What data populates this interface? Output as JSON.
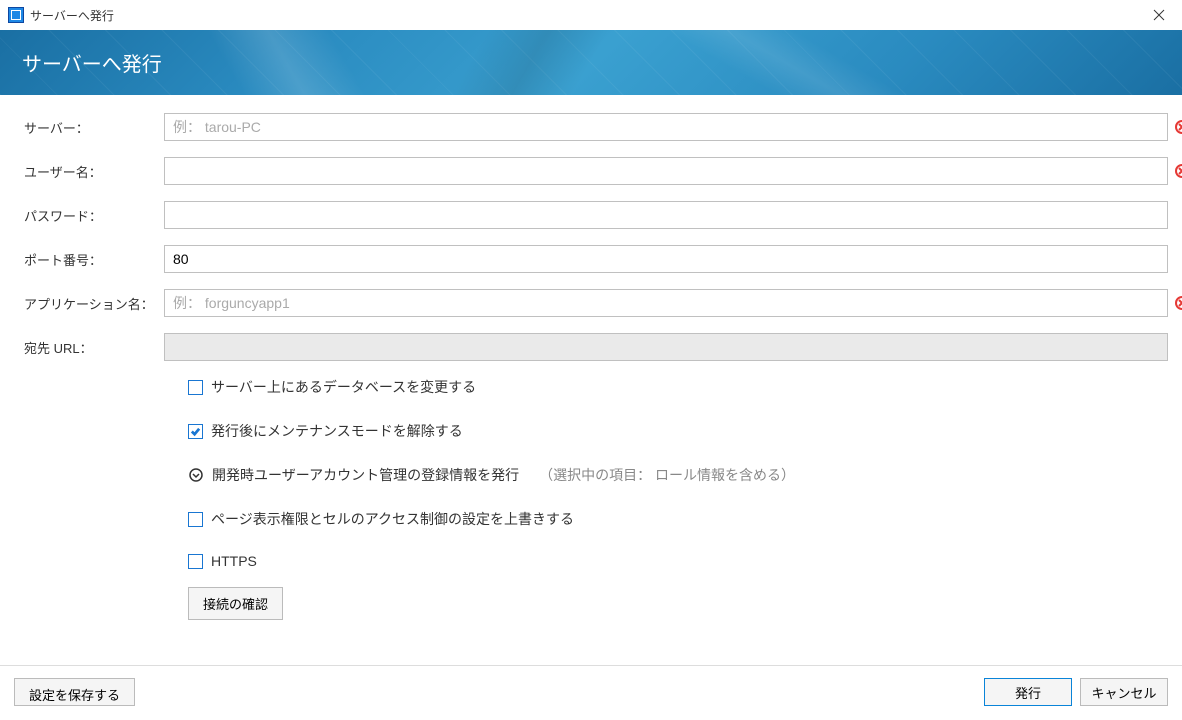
{
  "window": {
    "title": "サーバーへ発行"
  },
  "banner": {
    "heading": "サーバーへ発行"
  },
  "labels": {
    "server": "サーバー：",
    "username": "ユーザー名：",
    "password": "パスワード：",
    "port": "ポート番号：",
    "appname": "アプリケーション名：",
    "desturl": "宛先 URL："
  },
  "fields": {
    "server": {
      "value": "",
      "placeholder": "例： tarou-PC"
    },
    "username": {
      "value": ""
    },
    "password": {
      "value": ""
    },
    "port": {
      "value": "80"
    },
    "appname": {
      "value": "",
      "placeholder": "例： forguncyapp1"
    },
    "desturl": {
      "value": ""
    }
  },
  "options": {
    "change_db": {
      "label": "サーバー上にあるデータベースを変更する",
      "checked": false
    },
    "release_maintenance": {
      "label": "発行後にメンテナンスモードを解除する",
      "checked": true
    },
    "publish_accounts": {
      "label": "開発時ユーザーアカウント管理の登録情報を発行",
      "hint": "（選択中の項目： ロール情報を含める）"
    },
    "overwrite_perms": {
      "label": "ページ表示権限とセルのアクセス制御の設定を上書きする",
      "checked": false
    },
    "https": {
      "label": "HTTPS",
      "checked": false
    }
  },
  "buttons": {
    "test_connection": "接続の確認",
    "save_settings": "設定を保存する",
    "publish": "発行",
    "cancel": "キャンセル"
  }
}
